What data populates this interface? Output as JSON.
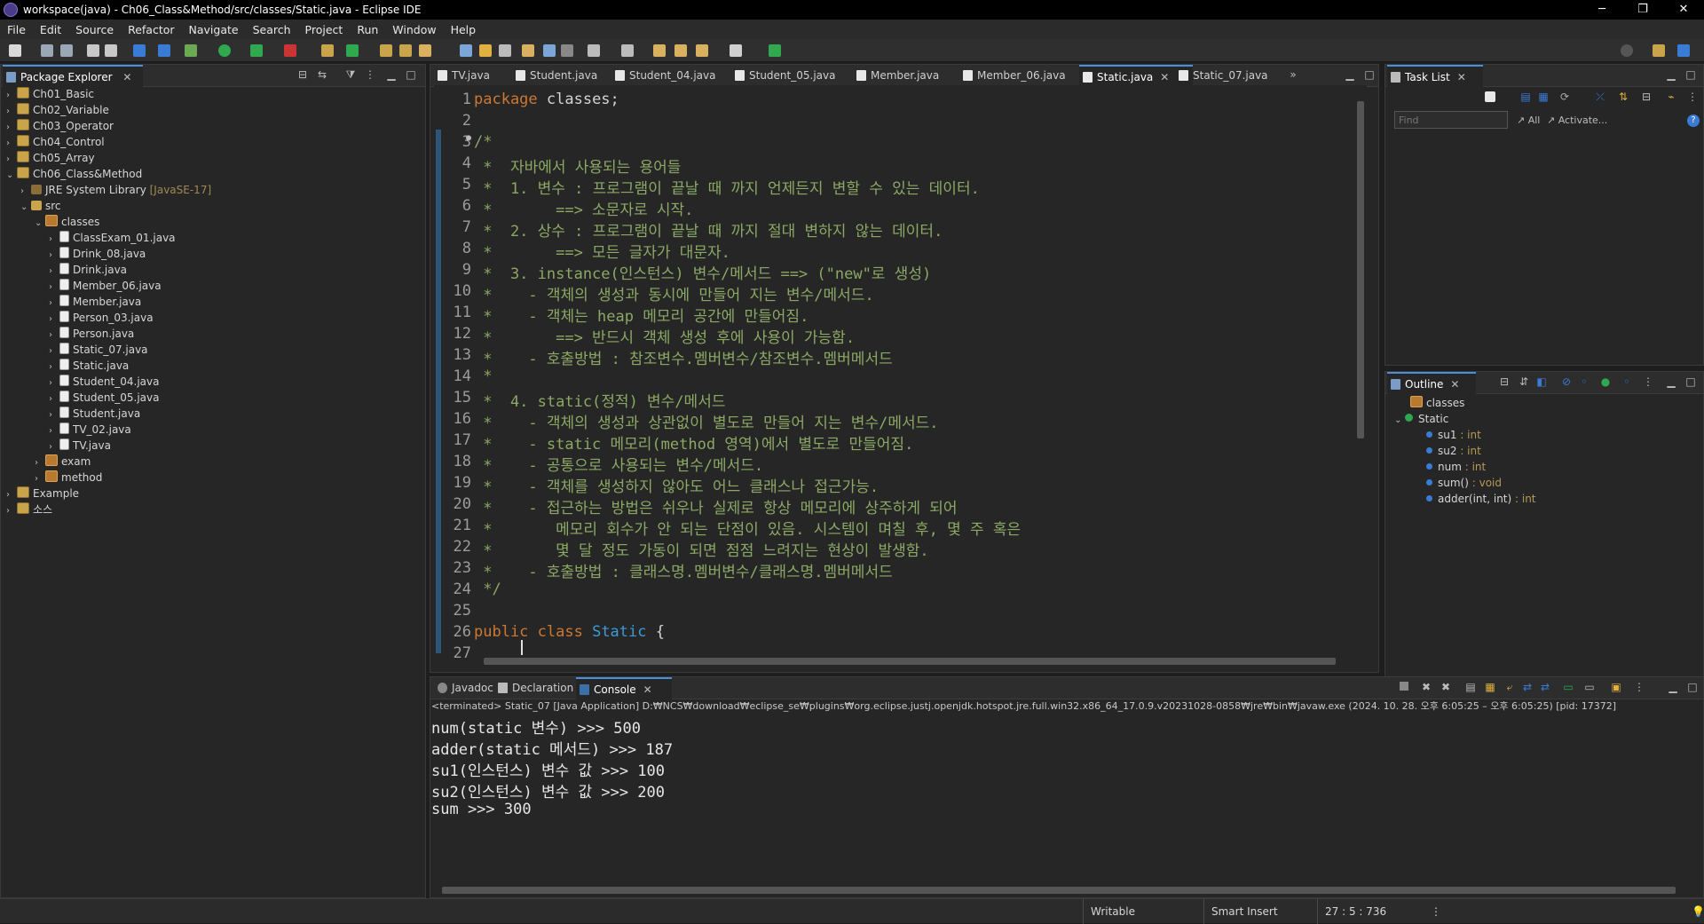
{
  "window": {
    "title": "workspace(java) - Ch06_Class&Method/src/classes/Static.java - Eclipse IDE",
    "controls": [
      "─",
      "❐",
      "✕"
    ]
  },
  "menu": [
    "File",
    "Edit",
    "Source",
    "Refactor",
    "Navigate",
    "Search",
    "Project",
    "Run",
    "Window",
    "Help"
  ],
  "package_explorer": {
    "title": "Package Explorer",
    "projects": [
      "Ch01_Basic",
      "Ch02_Variable",
      "Ch03_Operator",
      "Ch04_Control",
      "Ch05_Array"
    ],
    "ch06": {
      "name": "Ch06_Class&Method",
      "jre": "JRE System Library",
      "jre_version": "[JavaSE-17]",
      "src": "src",
      "pkg_classes": "classes",
      "files": [
        "ClassExam_01.java",
        "Drink_08.java",
        "Drink.java",
        "Member_06.java",
        "Member.java",
        "Person_03.java",
        "Person.java",
        "Static_07.java",
        "Static.java",
        "Student_04.java",
        "Student_05.java",
        "Student.java",
        "TV_02.java",
        "TV.java"
      ],
      "pkg_exam": "exam",
      "pkg_method": "method"
    },
    "other_projects": [
      "Example",
      "소스"
    ]
  },
  "editor": {
    "tabs": [
      "TV.java",
      "Student.java",
      "Student_04.java",
      "Student_05.java",
      "Member.java",
      "Member_06.java",
      "Static.java",
      "Static_07.java"
    ],
    "active_tab": "Static.java",
    "overflow": "»",
    "lines": [
      "package classes;",
      "",
      "/*",
      " *  자바에서 사용되는 용어들",
      " *  1. 변수 : 프로그램이 끝날 때 까지 언제든지 변할 수 있는 데이터.",
      " *       ==> 소문자로 시작.",
      " *  2. 상수 : 프로그램이 끝날 때 까지 절대 변하지 않는 데이터.",
      " *       ==> 모든 글자가 대문자.",
      " *  3. instance(인스턴스) 변수/메서드 ==> (\"new\"로 생성)",
      " *    - 객체의 생성과 동시에 만들어 지는 변수/메서드.",
      " *    - 객체는 heap 메모리 공간에 만들어짐.",
      " *       ==> 반드시 객체 생성 후에 사용이 가능함.",
      " *    - 호출방법 : 참조변수.멤버변수/참조변수.멤버메서드",
      " *",
      " *  4. static(정적) 변수/메서드",
      " *    - 객체의 생성과 상관없이 별도로 만들어 지는 변수/메서드.",
      " *    - static 메모리(method 영역)에서 별도로 만들어짐.",
      " *    - 공통으로 사용되는 변수/메서드.",
      " *    - 객체를 생성하지 않아도 어느 클래스나 접근가능.",
      " *    - 접근하는 방법은 쉬우나 실제로 항상 메모리에 상주하게 되어",
      " *       메모리 회수가 안 되는 단점이 있음. 시스템이 며칠 후, 몇 주 혹은",
      " *       몇 달 정도 가동이 되면 점점 느려지는 현상이 발생함.",
      " *    - 호출방법 : 클래스명.멤버변수/클래스명.멤버메서드",
      " */",
      "",
      "public class Static {",
      "    "
    ]
  },
  "task_list": {
    "title": "Task List",
    "find_placeholder": "Find",
    "all": "All",
    "activate": "Activate..."
  },
  "outline": {
    "title": "Outline",
    "package": "classes",
    "class": "Static",
    "members": [
      {
        "name": "su1",
        "type": " : int",
        "color": "#3a7bd5"
      },
      {
        "name": "su2",
        "type": " : int",
        "color": "#3a7bd5"
      },
      {
        "name": "num",
        "type": " : int",
        "color": "#3a7bd5"
      },
      {
        "name": "sum()",
        "type": " : void",
        "color": "#2fa84f"
      },
      {
        "name": "adder(int, int)",
        "type": " : int",
        "color": "#2fa84f"
      }
    ]
  },
  "bottom": {
    "tabs": [
      "Javadoc",
      "Declaration",
      "Console"
    ],
    "active_tab": "Console",
    "console_header": "<terminated> Static_07 [Java Application] D:₩NCS₩download₩eclipse_se₩plugins₩org.eclipse.justj.openjdk.hotspot.jre.full.win32.x86_64_17.0.9.v20231028-0858₩jre₩bin₩javaw.exe  (2024. 10. 28. 오후 6:05:25 – 오후 6:05:25) [pid: 17372]",
    "output": [
      "num(static 변수) >>> 500",
      "adder(static 메서드) >>> 187",
      "su1(인스턴스) 변수 값 >>> 100",
      "su2(인스턴스) 변수 값 >>> 200",
      "sum >>> 300"
    ]
  },
  "status": {
    "writable": "Writable",
    "insert_mode": "Smart Insert",
    "position": "27 : 5 : 736"
  }
}
